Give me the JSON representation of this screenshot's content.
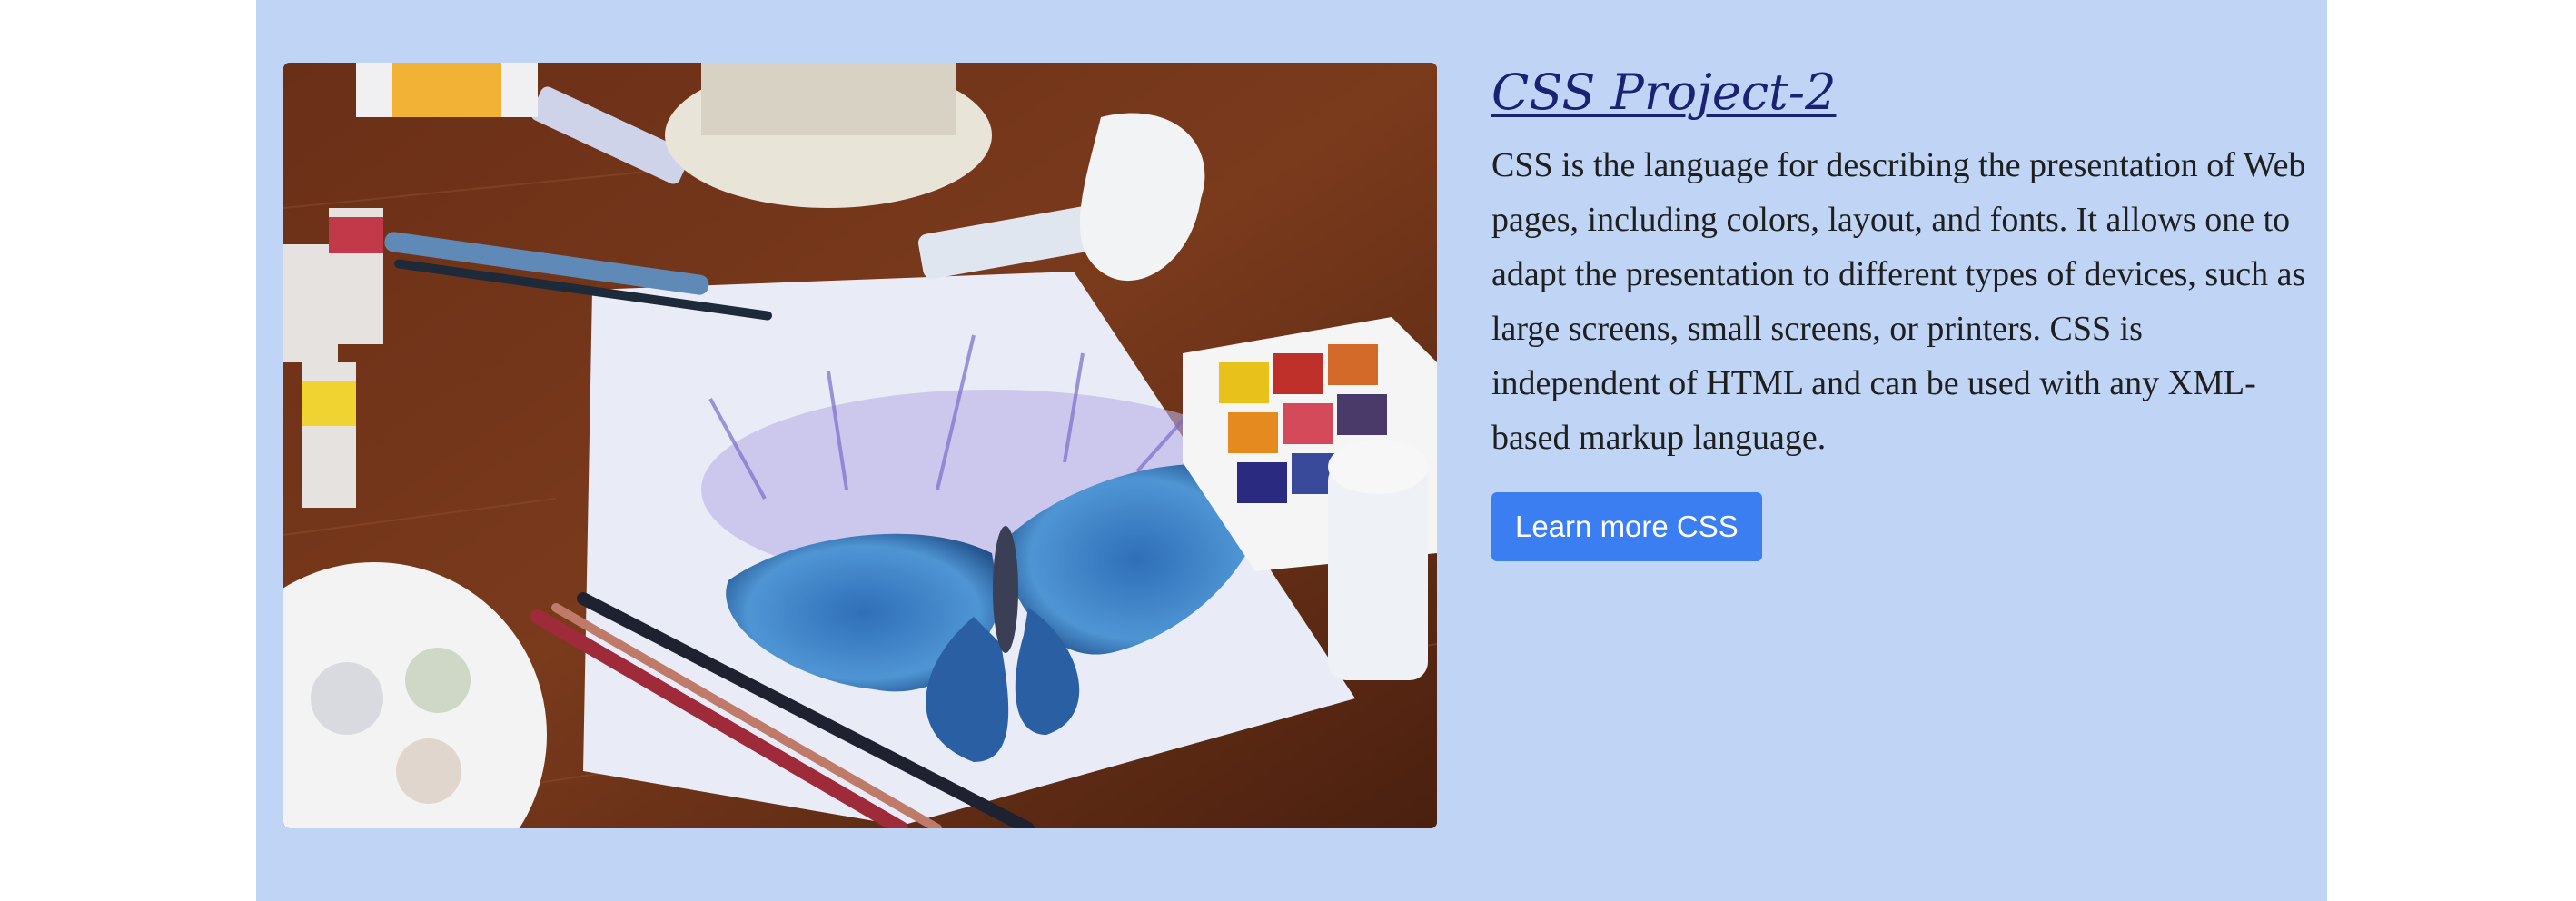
{
  "project": {
    "title": "CSS Project-2",
    "description": "CSS is the language for describing the presentation of Web pages, including colors, layout, and fonts. It allows one to adapt the presentation to different types of devices, such as large screens, small screens, or printers. CSS is independent of HTML and can be used with any XML-based markup language.",
    "button_label": "Learn more CSS"
  },
  "colors": {
    "card_background": "#c0d5f6",
    "title": "#1a2373",
    "button": "#3b7ef2"
  },
  "image": {
    "subject": "watercolor-butterfly-painting-on-art-desk"
  }
}
